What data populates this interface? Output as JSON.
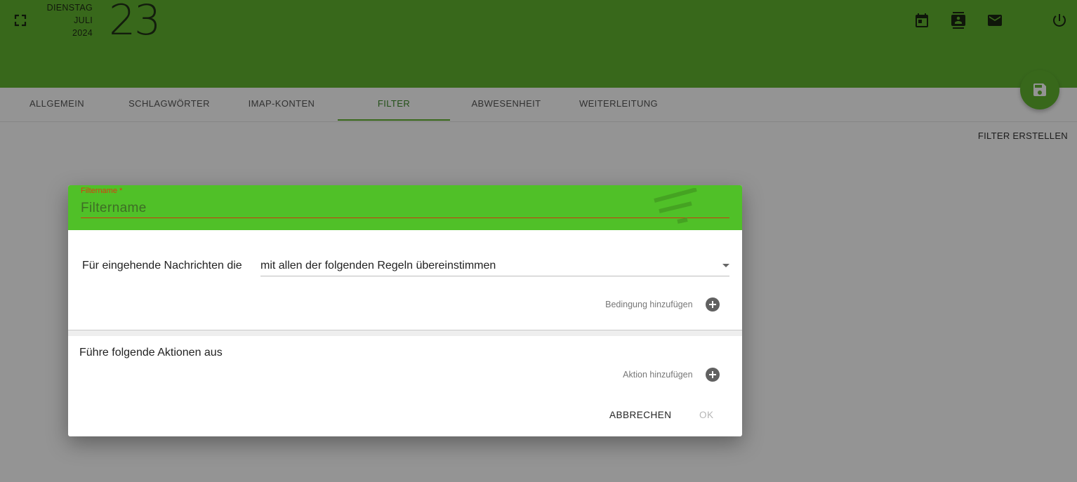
{
  "header": {
    "weekday": "DIENSTAG",
    "month": "JULI",
    "year": "2024",
    "day": "23",
    "icons": [
      "fullscreen-icon",
      "calendar-icon",
      "contacts-icon",
      "mail-icon",
      "power-icon"
    ]
  },
  "tabs": [
    {
      "label": "ALLGEMEIN",
      "active": false
    },
    {
      "label": "SCHLAGWÖRTER",
      "active": false
    },
    {
      "label": "IMAP-KONTEN",
      "active": false
    },
    {
      "label": "FILTER",
      "active": true
    },
    {
      "label": "ABWESENHEIT",
      "active": false
    },
    {
      "label": "WEITERLEITUNG",
      "active": false
    }
  ],
  "save_fab_icon": "save-icon",
  "create_filter_label": "FILTER ERSTELLEN",
  "dialog": {
    "filtername_label": "Filtername *",
    "filtername_placeholder": "Filtername",
    "filtername_value": "",
    "rule_prefix": "Für eingehende Nachrichten die",
    "match_selected": "mit allen der folgenden Regeln übereinstimmen",
    "add_condition_label": "Bedingung hinzufügen",
    "actions_title": "Führe folgende Aktionen aus",
    "add_action_label": "Aktion hinzufügen",
    "cancel_label": "ABBRECHEN",
    "ok_label": "OK"
  },
  "colors": {
    "primary": "#61b330",
    "dialog_header": "#50c028",
    "error": "#cc3a10"
  }
}
